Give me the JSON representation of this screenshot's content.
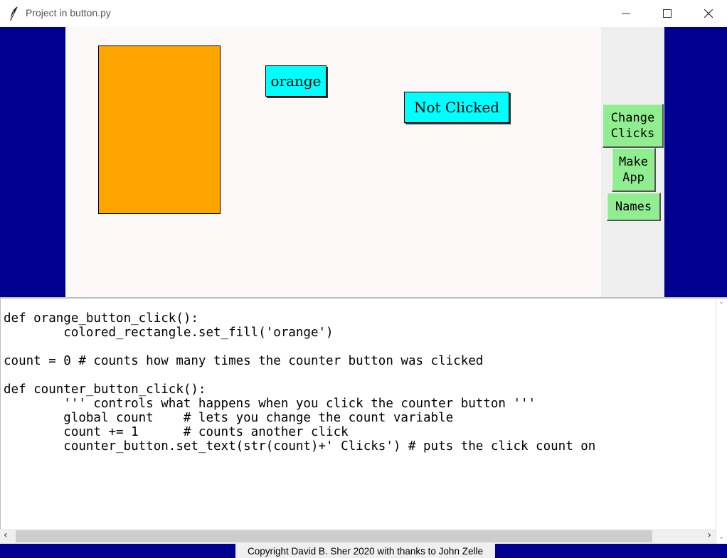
{
  "window": {
    "title": "Project in button.py",
    "controls": {
      "minimize_icon": "minimize-icon",
      "maximize_icon": "maximize-icon",
      "close_icon": "close-icon"
    }
  },
  "canvas": {
    "rectangle_color": "#ffa500",
    "orange_button_label": "orange",
    "counter_button_label": "Not Clicked",
    "button_color": "#00ffff"
  },
  "side_panel": {
    "change_clicks_label": "Change\nClicks",
    "make_app_label": "Make\nApp",
    "names_label": "Names",
    "button_color": "#90ee90"
  },
  "code": {
    "text": "def orange_button_click():\n        colored_rectangle.set_fill('orange')\n\ncount = 0 # counts how many times the counter button was clicked\n\ndef counter_button_click():\n        ''' controls what happens when you click the counter button '''\n        global count    # lets you change the count variable\n        count += 1      # counts another click\n        counter_button.set_text(str(count)+' Clicks') # puts the click count on"
  },
  "footer": {
    "copyright": "Copyright David B. Sher 2020 with thanks to John Zelle"
  },
  "colors": {
    "frame_background": "#000090",
    "canvas_background": "#fcf8f8"
  }
}
